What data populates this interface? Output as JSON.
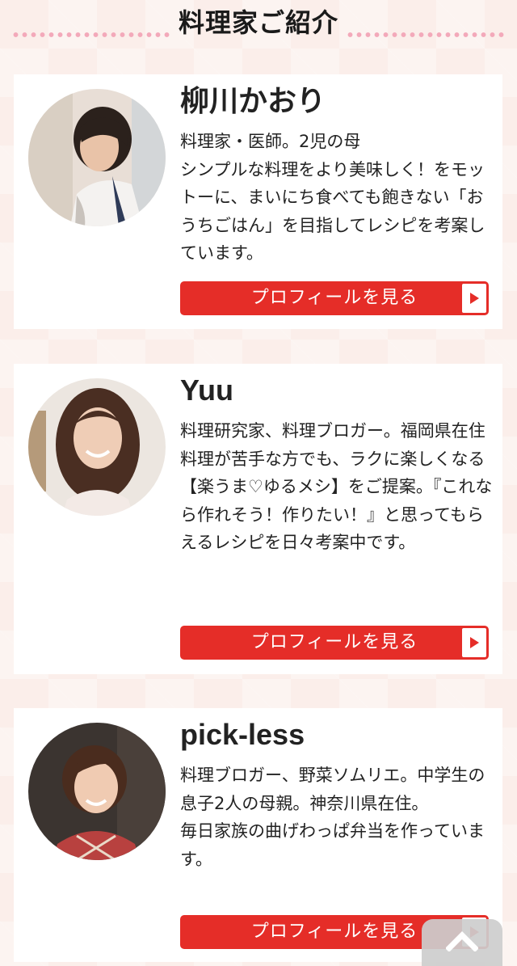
{
  "header": {
    "title": "料理家ご紹介"
  },
  "cooks": [
    {
      "name": "柳川かおり",
      "bio": "料理家・医師。2児の母\nシンプルな料理をより美味しく！をモットーに、まいにち食べても飽きない「おうちごはん」を目指してレシピを考案しています。",
      "button_label": "プロフィールを見る"
    },
    {
      "name": "Yuu",
      "bio": "料理研究家、料理ブロガー。福岡県在住\n料理が苦手な方でも、ラクに楽しくなる【楽うま♡ゆるメシ】をご提案。『これなら作れそう！作りたい！』と思ってもらえるレシピを日々考案中です。",
      "button_label": "プロフィールを見る"
    },
    {
      "name": "pick-less",
      "bio": "料理ブロガー、野菜ソムリエ。中学生の息子2人の母親。神奈川県在住。\n毎日家族の曲げわっぱ弁当を作っています。",
      "button_label": "プロフィールを見る"
    }
  ],
  "colors": {
    "accent": "#e52d28",
    "background": "#fbeeea",
    "deco": "#f3a9ba"
  },
  "icons": {
    "button_arrow": "play-arrow-icon",
    "scroll_top": "chevron-up-icon"
  }
}
